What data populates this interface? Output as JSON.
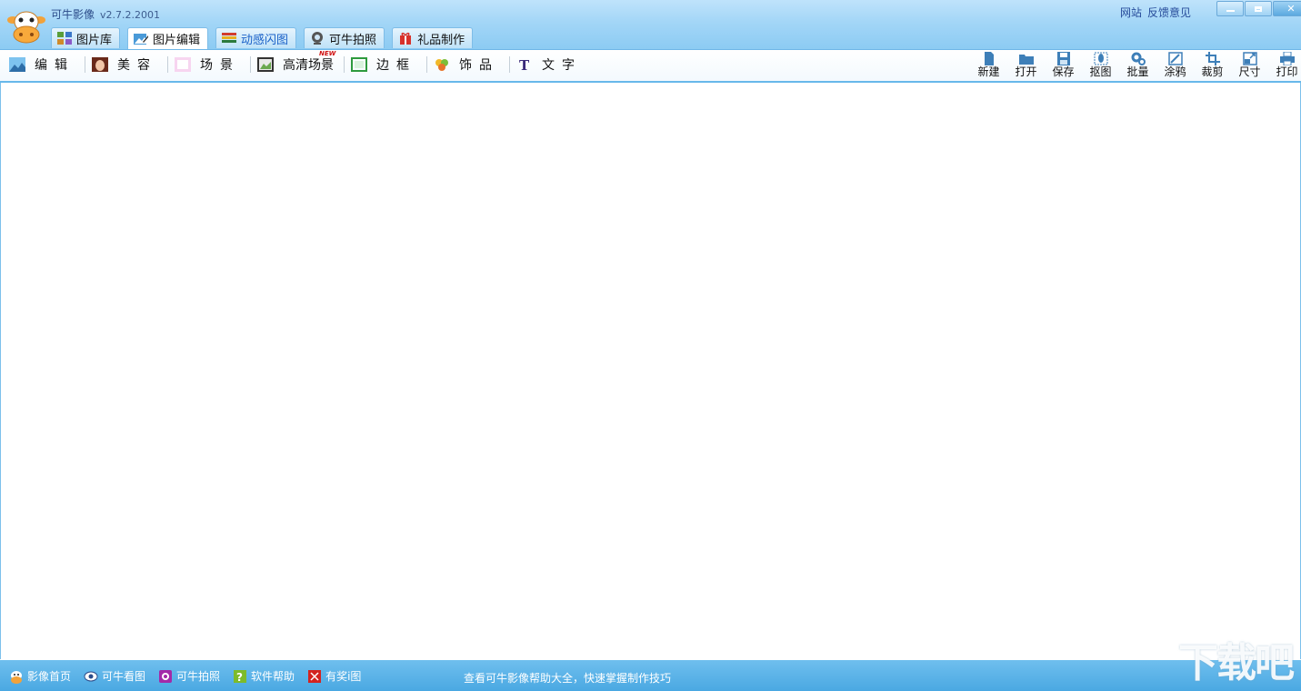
{
  "app": {
    "title": "可牛影像",
    "version": "v2.7.2.2001",
    "links": [
      "网站",
      "反馈意见"
    ]
  },
  "tabs": [
    {
      "label": "图片库",
      "icon": "gallery-icon",
      "active": false
    },
    {
      "label": "图片编辑",
      "icon": "photo-edit-icon",
      "active": true
    },
    {
      "label": "动感闪图",
      "icon": "flash-animation-icon",
      "active": false
    },
    {
      "label": "可牛拍照",
      "icon": "webcam-icon",
      "active": false
    },
    {
      "label": "礼品制作",
      "icon": "gift-icon",
      "active": false
    }
  ],
  "toolbar_left": [
    {
      "label": "编辑",
      "icon": "landscape-icon"
    },
    {
      "label": "美容",
      "icon": "face-icon"
    },
    {
      "label": "场景",
      "icon": "scene-icon"
    },
    {
      "label": "高清场景",
      "icon": "hd-scene-icon",
      "badge": "NEW"
    },
    {
      "label": "边框",
      "icon": "frame-icon"
    },
    {
      "label": "饰品",
      "icon": "clover-icon"
    },
    {
      "label": "文字",
      "icon": "text-icon"
    }
  ],
  "toolbar_right": [
    {
      "label": "新建",
      "icon": "new-file-icon"
    },
    {
      "label": "打开",
      "icon": "open-folder-icon"
    },
    {
      "label": "保存",
      "icon": "save-icon"
    },
    {
      "label": "抠图",
      "icon": "cutout-icon"
    },
    {
      "label": "批量",
      "icon": "batch-gear-icon"
    },
    {
      "label": "涂鸦",
      "icon": "doodle-icon"
    },
    {
      "label": "裁剪",
      "icon": "crop-icon"
    },
    {
      "label": "尺寸",
      "icon": "resize-icon"
    },
    {
      "label": "打印",
      "icon": "print-icon"
    }
  ],
  "footer": {
    "links": [
      {
        "label": "影像首页",
        "icon": "cow-icon"
      },
      {
        "label": "可牛看图",
        "icon": "eye-icon"
      },
      {
        "label": "可牛拍照",
        "icon": "camera-icon"
      },
      {
        "label": "软件帮助",
        "icon": "help-icon"
      },
      {
        "label": "有奖i图",
        "icon": "prize-icon"
      }
    ],
    "tip": "查看可牛影像帮助大全，快速掌握制作技巧"
  },
  "watermark": "下载吧",
  "colors": {
    "accent": "#4aa8e2",
    "header": "#a3d6f7",
    "link": "#264b9a"
  }
}
